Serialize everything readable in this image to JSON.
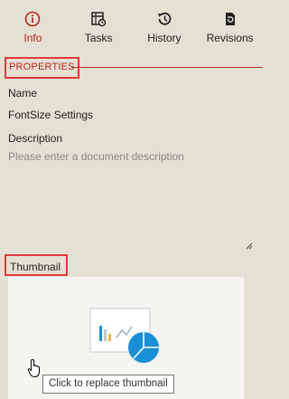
{
  "tabs": [
    {
      "label": "Info",
      "icon": "info-circle-icon",
      "active": true
    },
    {
      "label": "Tasks",
      "icon": "tasks-icon",
      "active": false
    },
    {
      "label": "History",
      "icon": "history-icon",
      "active": false
    },
    {
      "label": "Revisions",
      "icon": "revisions-icon",
      "active": false
    }
  ],
  "properties": {
    "title": "PROPERTIES",
    "name_label": "Name",
    "name_value": "FontSize Settings",
    "description_label": "Description",
    "description_placeholder": "Please enter a document description",
    "description_value": ""
  },
  "thumbnail": {
    "label": "Thumbnail",
    "tooltip": "Click to replace thumbnail"
  },
  "colors": {
    "accent_red": "#b5271f",
    "highlight_box": "#e0393e",
    "background": "#e4e0d3",
    "thumbnail_blue": "#1b8fd6"
  }
}
